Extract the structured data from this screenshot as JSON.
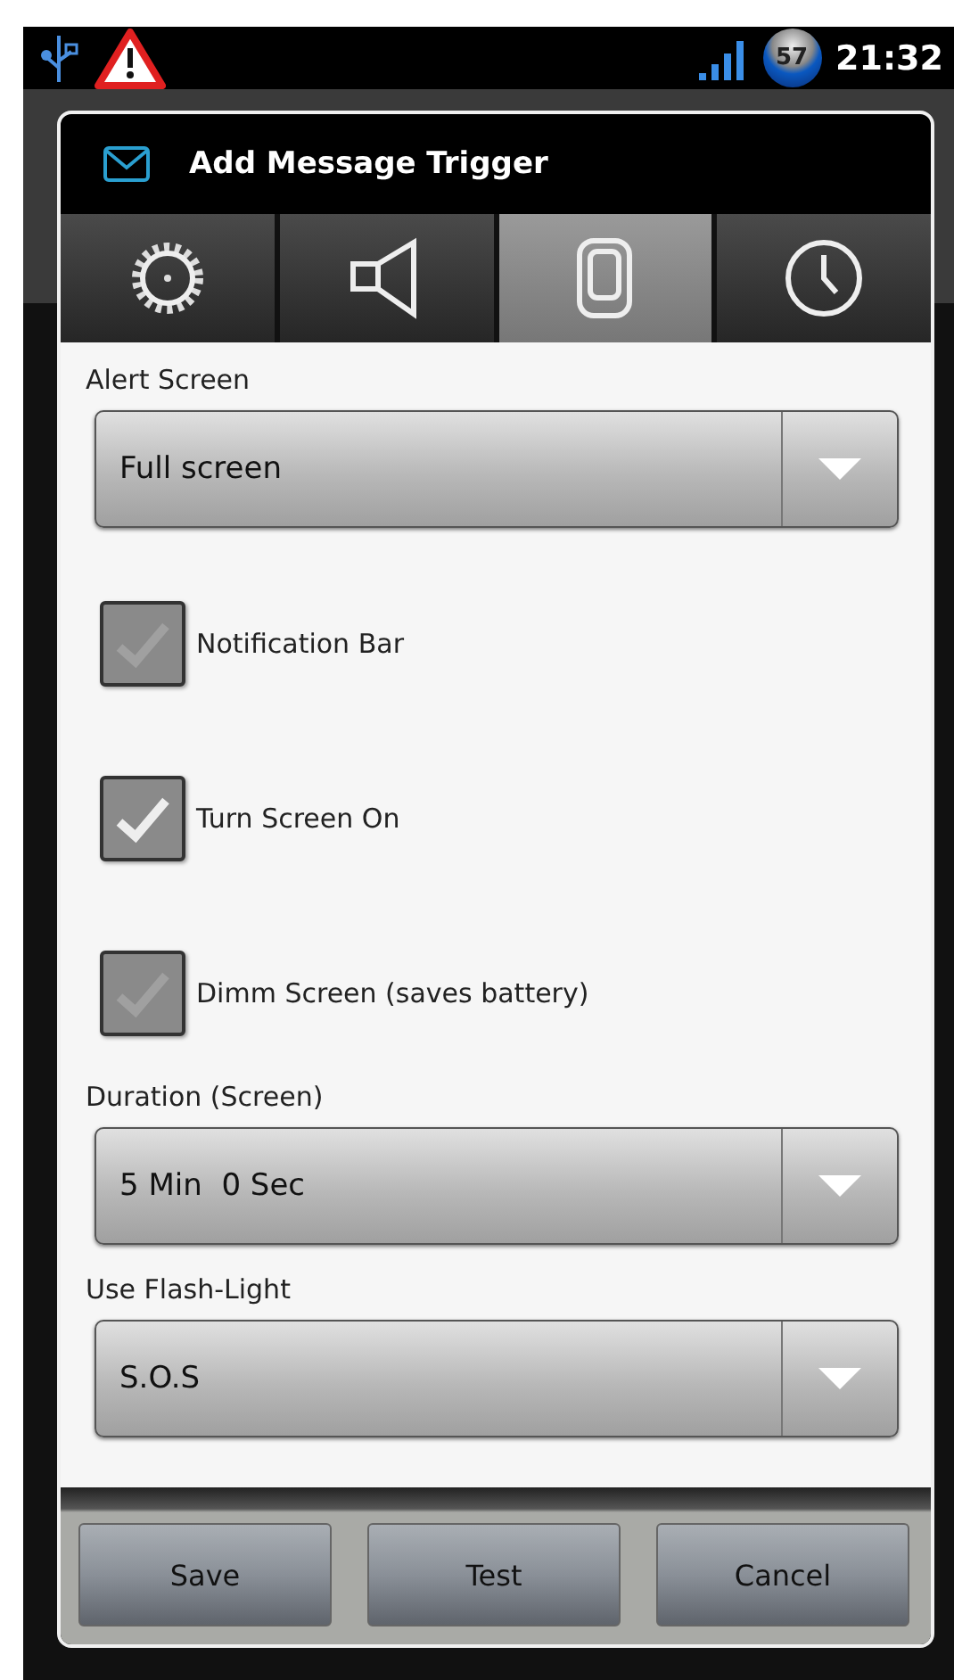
{
  "status_bar": {
    "badge": "57",
    "time": "21:32"
  },
  "dialog": {
    "title": "Add Message Trigger",
    "tabs": [
      {
        "kind": "gear",
        "selected": false
      },
      {
        "kind": "speaker",
        "selected": false
      },
      {
        "kind": "phone",
        "selected": true
      },
      {
        "kind": "clock",
        "selected": false
      }
    ],
    "sections": [
      {
        "kind": "select",
        "label": "Alert Screen",
        "value": "Full screen"
      },
      {
        "kind": "checkbox",
        "label": "Notification Bar",
        "checked": false
      },
      {
        "kind": "checkbox",
        "label": "Turn Screen On",
        "checked": true
      },
      {
        "kind": "checkbox",
        "label": "Dimm Screen (saves battery)",
        "checked": false
      },
      {
        "kind": "select",
        "label": "Duration (Screen)",
        "value": "5 Min  0 Sec"
      },
      {
        "kind": "select",
        "label": "Use Flash-Light",
        "value": "S.O.S"
      }
    ],
    "buttons": [
      "Save",
      "Test",
      "Cancel"
    ]
  }
}
